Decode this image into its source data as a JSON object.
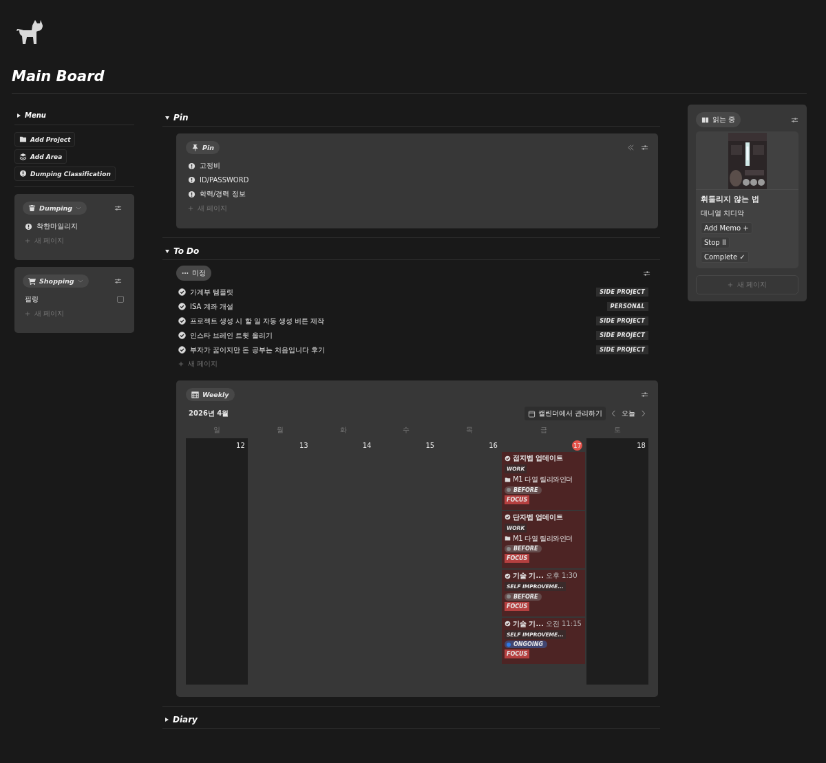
{
  "board": {
    "title": "Main Board"
  },
  "sidebar": {
    "menu": {
      "label": "Menu",
      "expanded": false
    },
    "actions": [
      {
        "label": "Add Project"
      },
      {
        "label": "Add Area"
      },
      {
        "label": "Dumping Classification"
      }
    ],
    "panels": [
      {
        "title": "Dumping",
        "items": [
          {
            "label": "착한마일리지",
            "kind": "page"
          }
        ],
        "new_page": "새 페이지"
      },
      {
        "title": "Shopping",
        "items": [
          {
            "label": "필링",
            "kind": "checkbox",
            "checked": false
          }
        ],
        "new_page": "새 페이지"
      }
    ]
  },
  "pin": {
    "heading": "Pin",
    "expanded": true,
    "card_title": "Pin",
    "items": [
      "고정비",
      "ID/PASSWORD",
      "학력/경력 정보"
    ],
    "new_page": "새 페이지"
  },
  "todo": {
    "heading": "To Do",
    "expanded": true,
    "group": "미정",
    "items": [
      {
        "label": "가계부 템플릿",
        "tag": "SIDE PROJECT",
        "done": true
      },
      {
        "label": "ISA 계좌 개설",
        "tag": "PERSONAL",
        "done": true
      },
      {
        "label": "프로젝트 생성 시 할 일 자동 생성 버튼 제작",
        "tag": "SIDE PROJECT",
        "done": true
      },
      {
        "label": "인스타 브레인 트윗 올리기",
        "tag": "SIDE PROJECT",
        "done": true
      },
      {
        "label": "부자가 꿈이지만 돈 공부는 처음입니다 후기",
        "tag": "SIDE PROJECT",
        "done": true
      }
    ],
    "new_page": "새 페이지"
  },
  "weekly": {
    "title": "Weekly",
    "month": "2026년 4월",
    "manage": "캘린더에서 관리하기",
    "today_button": "오늘",
    "weekdays": [
      "일",
      "월",
      "화",
      "수",
      "목",
      "금",
      "토"
    ],
    "days": [
      {
        "date": "12",
        "weekend": true,
        "today": false
      },
      {
        "date": "13",
        "weekend": false,
        "today": false
      },
      {
        "date": "14",
        "weekend": false,
        "today": false
      },
      {
        "date": "15",
        "weekend": false,
        "today": false
      },
      {
        "date": "16",
        "weekend": false,
        "today": false
      },
      {
        "date": "17",
        "weekend": false,
        "today": true,
        "events": [
          {
            "title": "접지벱 업데이트",
            "category": "WORK",
            "project": "M1 다열 릴리와인더",
            "status": {
              "label": "BEFORE",
              "color": "#8a8a8a"
            },
            "priority": "FOCUS"
          },
          {
            "title": "단자벱 업데이트",
            "category": "WORK",
            "project": "M1 다열 릴리와인더",
            "status": {
              "label": "BEFORE",
              "color": "#8a8a8a"
            },
            "priority": "FOCUS"
          },
          {
            "title": "기술 기...",
            "time": "오후 1:30",
            "category": "SELF IMPROVEME...",
            "status": {
              "label": "BEFORE",
              "color": "#8a8a8a"
            },
            "priority": "FOCUS"
          },
          {
            "title": "기술 기...",
            "time": "오전 11:15",
            "category": "SELF IMPROVEME...",
            "status": {
              "label": "ONGOING",
              "color": "#2f7ae5"
            },
            "priority": "FOCUS"
          }
        ]
      },
      {
        "date": "18",
        "weekend": true,
        "today": false
      }
    ]
  },
  "diary": {
    "heading": "Diary",
    "expanded": false
  },
  "reading": {
    "title": "읽는 중",
    "book": {
      "title": "휘둘리지 않는 법",
      "author": "대니얼 치디악",
      "actions": [
        "Add Memo +",
        "Stop II",
        "Complete ✓"
      ]
    },
    "new_page": "새 페이지"
  }
}
